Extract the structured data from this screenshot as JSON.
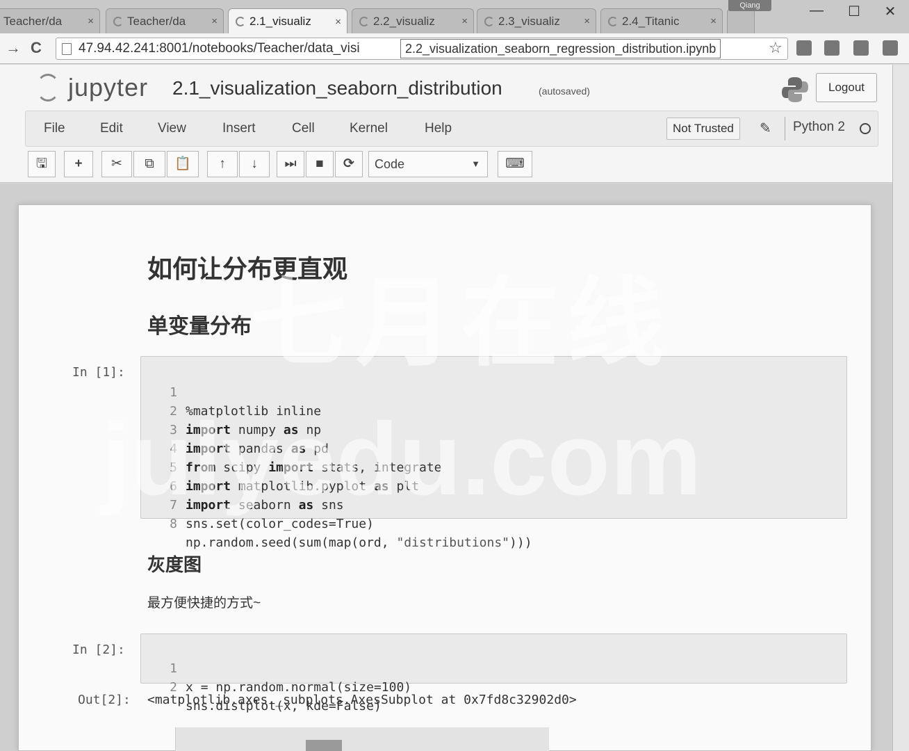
{
  "browser": {
    "tabs": [
      {
        "label": "Teacher/da"
      },
      {
        "label": "Teacher/da"
      },
      {
        "label": "2.1_visualiz"
      },
      {
        "label": "2.2_visualiz"
      },
      {
        "label": "2.3_visualiz"
      },
      {
        "label": "2.4_Titanic"
      }
    ],
    "tab_close": "×",
    "profile": "Qiang",
    "window_controls": {
      "minimize": "—",
      "maximize": "☐",
      "close": "✕"
    },
    "back": "→",
    "reload": "C",
    "url": "47.94.42.241:8001/notebooks/Teacher/data_visi",
    "tooltip": "2.2_visualization_seaborn_regression_distribution.ipynb",
    "star": "☆"
  },
  "header": {
    "logo_text": "jupyter",
    "notebook_title": "2.1_visualization_seaborn_distribution",
    "autosave_status": "(autosaved)",
    "logout_label": "Logout"
  },
  "menubar": {
    "items": [
      "File",
      "Edit",
      "View",
      "Insert",
      "Cell",
      "Kernel",
      "Help"
    ],
    "trust_label": "Not Trusted",
    "pencil": "✎",
    "kernel_name": "Python 2"
  },
  "toolbar": {
    "save": "🖫",
    "insert": "+",
    "cut": "✂",
    "copy": "⧉",
    "paste": "📋",
    "move_up": "↑",
    "move_down": "↓",
    "run": "⏭",
    "stop": "■",
    "restart": "⟳",
    "cell_type": "Code",
    "caret": "▼",
    "keyboard": "⌨"
  },
  "notebook": {
    "heading1": "如何让分布更直观",
    "heading2": "单变量分布",
    "heading3": "灰度图",
    "paragraph": "最方便快捷的方式~",
    "cell1": {
      "prompt": "In  [1]:",
      "lines": [
        {
          "n": "1",
          "text": "%matplotlib inline"
        },
        {
          "n": "2",
          "text": "import numpy as np"
        },
        {
          "n": "3",
          "text": "import pandas as pd"
        },
        {
          "n": "4",
          "text": "from scipy import stats, integrate"
        },
        {
          "n": "5",
          "text": "import matplotlib.pyplot as plt"
        },
        {
          "n": "6",
          "text": "import seaborn as sns"
        },
        {
          "n": "7",
          "text": "sns.set(color_codes=True)"
        },
        {
          "n": "8",
          "text": "np.random.seed(sum(map(ord, \"distributions\")))"
        }
      ]
    },
    "cell2": {
      "prompt": "In  [2]:",
      "lines": [
        {
          "n": "1",
          "text": "x = np.random.normal(size=100)"
        },
        {
          "n": "2",
          "text": "sns.distplot(x, kde=False)"
        }
      ],
      "out_prompt": "Out[2]:",
      "output": "<matplotlib.axes._subplots.AxesSubplot at 0x7fd8c32902d0>"
    }
  },
  "watermark": {
    "cn": "七月在线",
    "url": "julyedu.com"
  }
}
